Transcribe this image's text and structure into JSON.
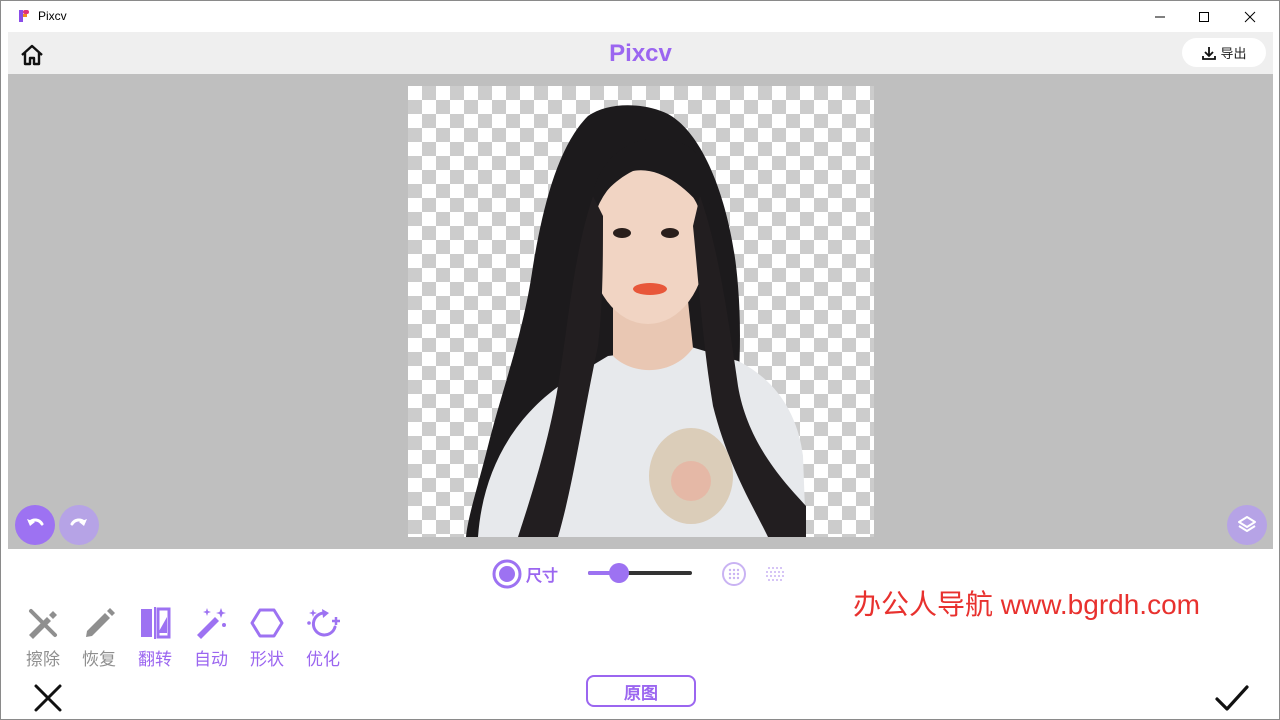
{
  "window": {
    "app_name": "Pixcv"
  },
  "header": {
    "title": "Pixcv",
    "export_label": "导出"
  },
  "canvas": {
    "image_subject": "portrait-cutout"
  },
  "brush": {
    "size_label": "尺寸",
    "size_value": 0.2
  },
  "tools": [
    {
      "id": "erase",
      "label": "擦除",
      "icon": "erase-icon",
      "active": false
    },
    {
      "id": "restore",
      "label": "恢复",
      "icon": "pencil-icon",
      "active": false
    },
    {
      "id": "flip",
      "label": "翻转",
      "icon": "flip-icon",
      "active": true
    },
    {
      "id": "auto",
      "label": "自动",
      "icon": "magic-wand-icon",
      "active": true
    },
    {
      "id": "shape",
      "label": "形状",
      "icon": "hexagon-icon",
      "active": true
    },
    {
      "id": "optimize",
      "label": "优化",
      "icon": "sparkle-refresh-icon",
      "active": true
    }
  ],
  "footer": {
    "original_label": "原图"
  },
  "watermark": "办公人导航 www.bgrdh.com",
  "colors": {
    "accent": "#9b66f0",
    "canvas_bg": "#bfbfbf",
    "watermark": "#e8312e"
  }
}
